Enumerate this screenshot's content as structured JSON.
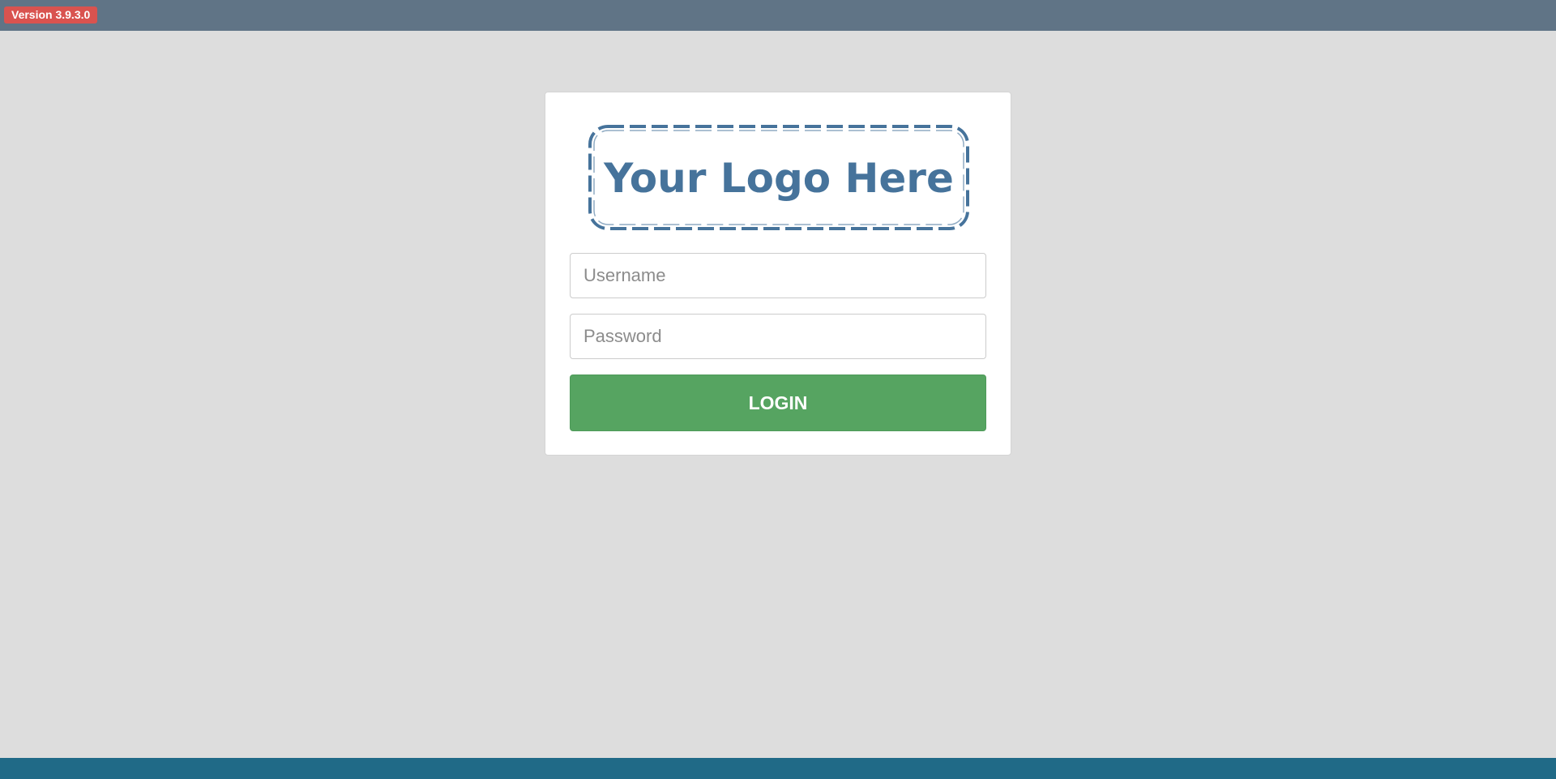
{
  "header": {
    "version_label": "Version 3.9.3.0"
  },
  "login": {
    "logo_text": "Your Logo Here",
    "username_placeholder": "Username",
    "password_placeholder": "Password",
    "login_label": "LOGIN"
  },
  "colors": {
    "topbar": "#607486",
    "version_badge": "#d9534f",
    "background": "#dddddd",
    "footer": "#206a87",
    "logo": "#46739b",
    "login_button": "#56a461"
  }
}
